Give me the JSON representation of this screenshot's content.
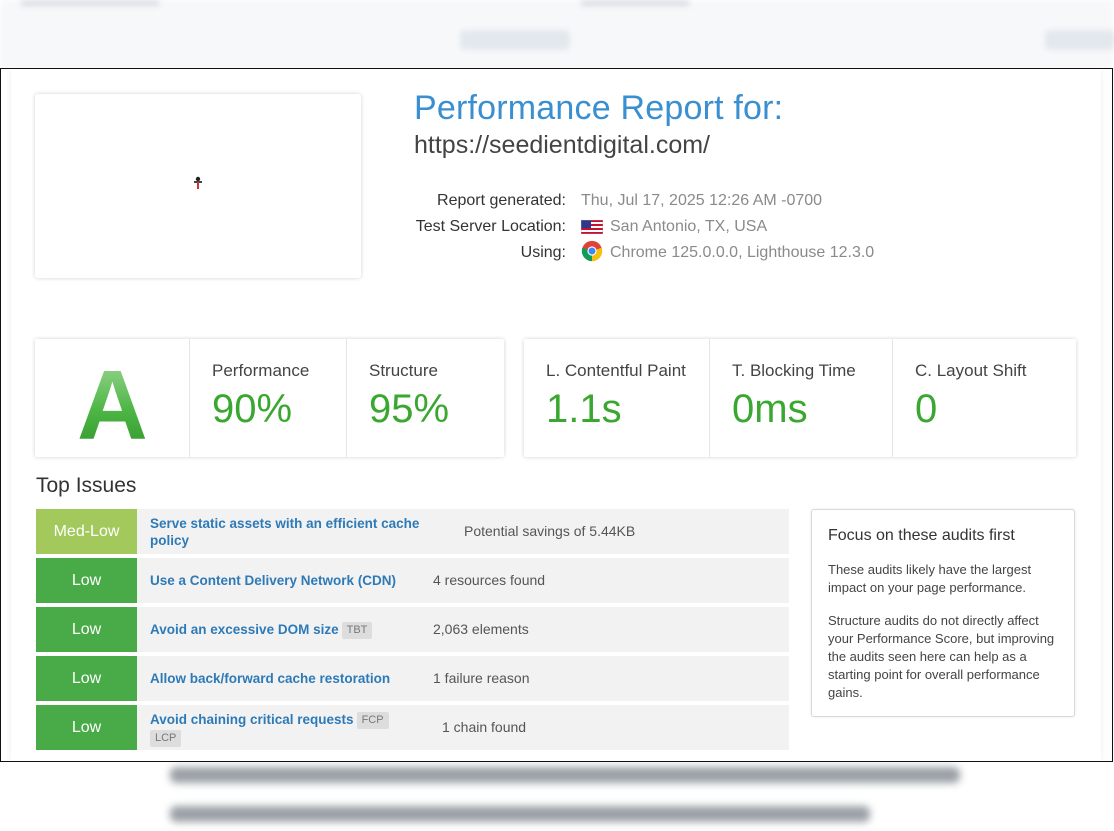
{
  "header": {
    "title": "Performance Report for:",
    "url": "https://seedientdigital.com/"
  },
  "meta": [
    {
      "label": "Report generated:",
      "value": "Thu, Jul 17, 2025 12:26 AM -0700",
      "icon": ""
    },
    {
      "label": "Test Server Location:",
      "value": "San Antonio, TX, USA",
      "icon": "us-flag-icon"
    },
    {
      "label": "Using:",
      "value": "Chrome 125.0.0.0, Lighthouse 12.3.0",
      "icon": "chrome-icon"
    }
  ],
  "scores": {
    "grade": "A",
    "performance": {
      "label": "Performance",
      "value": "90%"
    },
    "structure": {
      "label": "Structure",
      "value": "95%"
    }
  },
  "vitals": {
    "lcp": {
      "label": "L. Contentful Paint",
      "value": "1.1s"
    },
    "tbt": {
      "label": "T. Blocking Time",
      "value": "0ms"
    },
    "cls": {
      "label": "C. Layout Shift",
      "value": "0"
    }
  },
  "issues_title": "Top Issues",
  "issues": [
    {
      "severity": "Med-Low",
      "name": "Serve static assets with an efficient cache policy",
      "tags": [],
      "detail": "Potential savings of 5.44KB"
    },
    {
      "severity": "Low",
      "name": "Use a Content Delivery Network (CDN)",
      "tags": [],
      "detail": "4 resources found"
    },
    {
      "severity": "Low",
      "name": "Avoid an excessive DOM size",
      "tags": [
        "TBT"
      ],
      "detail": "2,063 elements"
    },
    {
      "severity": "Low",
      "name": "Allow back/forward cache restoration",
      "tags": [],
      "detail": "1 failure reason"
    },
    {
      "severity": "Low",
      "name": "Avoid chaining critical requests",
      "tags": [
        "FCP",
        "LCP"
      ],
      "detail": "1 chain found"
    }
  ],
  "focus": {
    "title": "Focus on these audits first",
    "p1": "These audits likely have the largest impact on your page performance.",
    "p2": "Structure audits do not directly affect your Performance Score, but improving the audits seen here can help as a starting point for overall performance gains."
  },
  "colors": {
    "accent": "#3a8fd0",
    "green": "#3aa830",
    "med_low": "#a3c95d",
    "low": "#49ab48",
    "link": "#2e7ab7"
  }
}
